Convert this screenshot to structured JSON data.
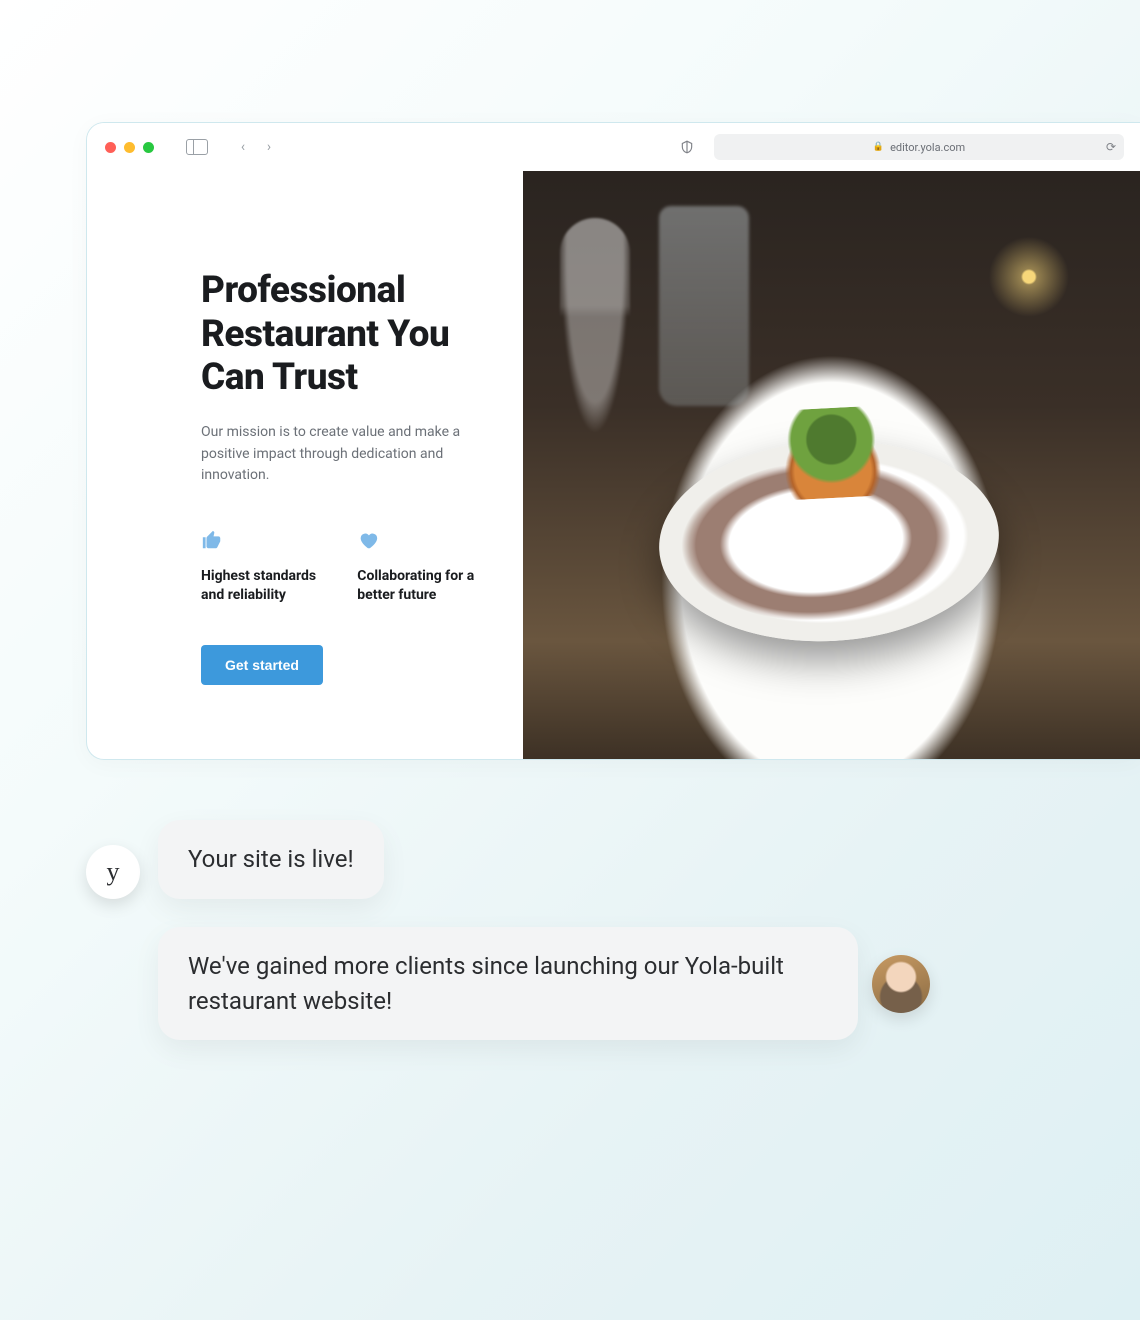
{
  "browser": {
    "url": "editor.yola.com",
    "traffic_lights": {
      "red": "#ff5f57",
      "yellow": "#febc2e",
      "green": "#28c840"
    }
  },
  "hero": {
    "headline": "Professional Restaurant You Can Trust",
    "mission": "Our mission is to create value and make a positive impact through dedication and innovation.",
    "features": [
      {
        "icon": "thumbs-up-icon",
        "label": "Highest standards and reliability"
      },
      {
        "icon": "heart-icon",
        "label": "Collaborating for a better future"
      }
    ],
    "cta_label": "Get started",
    "accent_color": "#3d99dc",
    "image_alt": "Plated gourmet dish on a restaurant table with wine glasses"
  },
  "chat": {
    "yola_avatar_glyph": "y",
    "live_message": "Your site is live!",
    "testimonial": "We've gained more clients since launching our Yola-built restaurant website!"
  }
}
